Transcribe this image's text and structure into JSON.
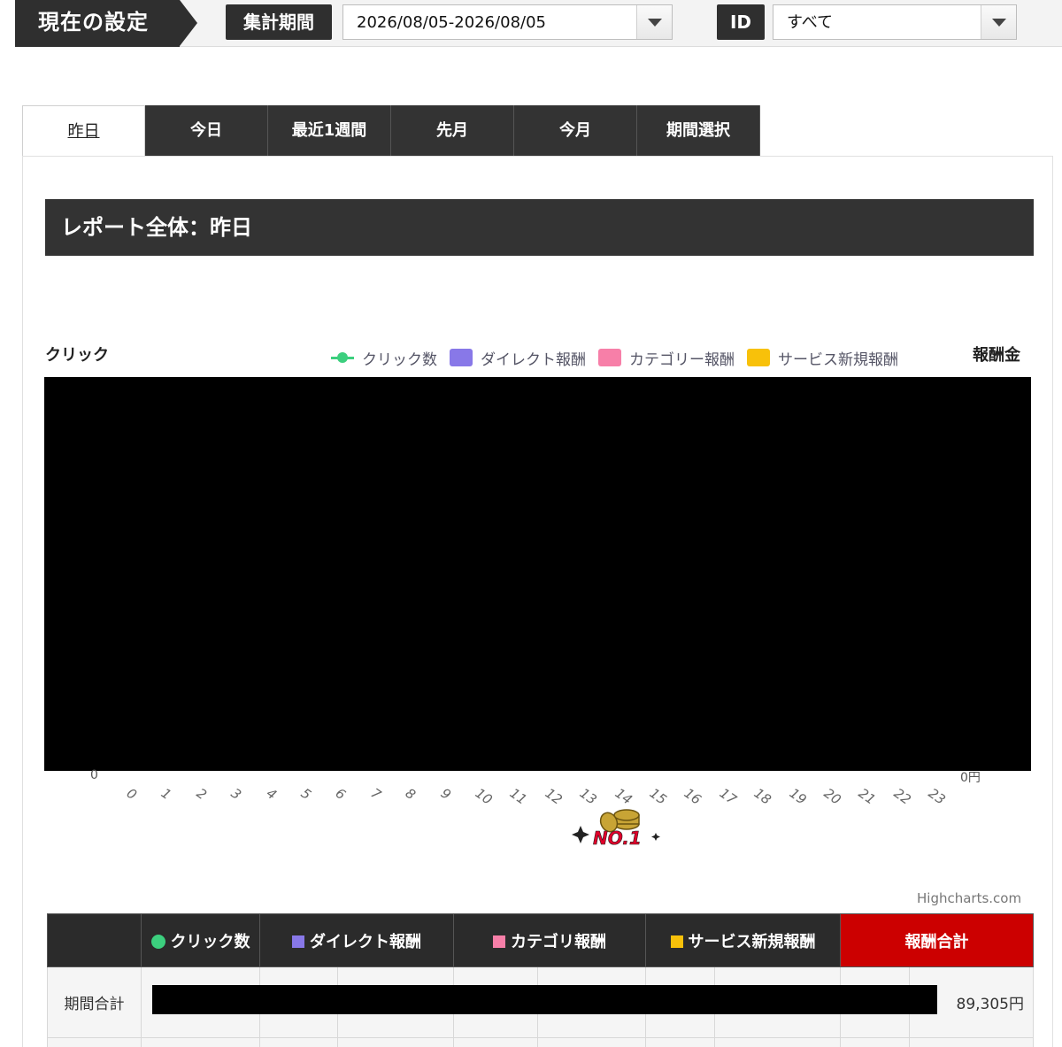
{
  "settings": {
    "title": "現在の設定",
    "period_label": "集計期間",
    "period_value": "2026/08/05-2026/08/05",
    "id_label": "ID",
    "id_value": "すべて"
  },
  "tabs": [
    {
      "label": "昨日",
      "active": true
    },
    {
      "label": "今日",
      "active": false
    },
    {
      "label": "最近1週間",
      "active": false
    },
    {
      "label": "先月",
      "active": false
    },
    {
      "label": "今月",
      "active": false
    },
    {
      "label": "期間選択",
      "active": false
    }
  ],
  "report": {
    "title": "レポート全体：昨日"
  },
  "chart": {
    "left_axis_title": "クリック",
    "right_axis_title": "報酬金",
    "left_axis_zero": "0",
    "right_axis_zero": "0円",
    "credits": "Highcharts.com",
    "legend": [
      {
        "label": "クリック数",
        "color": "#3ccf7e",
        "kind": "line"
      },
      {
        "label": "ダイレクト報酬",
        "color": "#8878e8",
        "kind": "bar"
      },
      {
        "label": "カテゴリー報酬",
        "color": "#f77fa8",
        "kind": "bar"
      },
      {
        "label": "サービス新規報酬",
        "color": "#f8c10a",
        "kind": "bar"
      }
    ]
  },
  "chart_data": {
    "type": "bar",
    "categories": [
      "0",
      "1",
      "2",
      "3",
      "4",
      "5",
      "6",
      "7",
      "8",
      "9",
      "10",
      "11",
      "12",
      "13",
      "14",
      "15",
      "16",
      "17",
      "18",
      "19",
      "20",
      "21",
      "22",
      "23"
    ],
    "series": [
      {
        "name": "クリック数"
      },
      {
        "name": "ダイレクト報酬"
      },
      {
        "name": "カテゴリー報酬"
      },
      {
        "name": "サービス新規報酬"
      }
    ],
    "ylabel": "クリック",
    "y2label": "報酬金",
    "legend_position": "top",
    "redacted": true
  },
  "badge": {
    "text": "NO.1",
    "icon": "coins-icon"
  },
  "table": {
    "headers": [
      {
        "label": "",
        "color": ""
      },
      {
        "label": "クリック数",
        "color": "#3ccf7e",
        "marker": "dot"
      },
      {
        "label": "ダイレクト報酬",
        "color": "#8878e8",
        "marker": "square"
      },
      {
        "label": "カテゴリ報酬",
        "color": "#f77fa8",
        "marker": "square"
      },
      {
        "label": "サービス新規報酬",
        "color": "#f8c10a",
        "marker": "square"
      },
      {
        "label": "報酬合計",
        "color": "",
        "marker": "none"
      }
    ],
    "row_label": "期間合計",
    "total_value": "89,305円"
  }
}
